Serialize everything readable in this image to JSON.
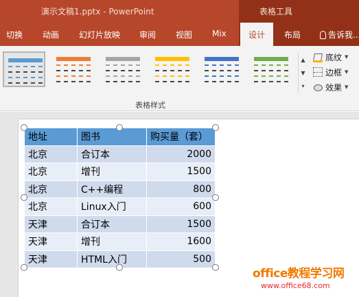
{
  "window": {
    "title": "演示文稿1.pptx - PowerPoint",
    "context_group": "表格工具"
  },
  "tabs": {
    "items": [
      "切换",
      "动画",
      "幻灯片放映",
      "审阅",
      "视图",
      "Mix",
      "设计",
      "布局"
    ],
    "active": "设计",
    "tell_me": "告诉我..."
  },
  "ribbon": {
    "group_label": "表格样式",
    "style_colors": [
      "#5b9bd5",
      "#ed7d31",
      "#a5a5a5",
      "#ffc000",
      "#4472c4",
      "#70ad47"
    ],
    "selected_style_index": 0,
    "shading": "底纹",
    "borders": "边框",
    "effects": "效果"
  },
  "table": {
    "headers": [
      "地址",
      "图书",
      "购买量（套）"
    ],
    "rows": [
      [
        "北京",
        "合订本",
        "2000"
      ],
      [
        "北京",
        "增刊",
        "1500"
      ],
      [
        "北京",
        "C++编程",
        "800"
      ],
      [
        "北京",
        "Linux入门",
        "600"
      ],
      [
        "天津",
        "合订本",
        "1500"
      ],
      [
        "天津",
        "增刊",
        "1600"
      ],
      [
        "天津",
        "HTML入门",
        "500"
      ]
    ],
    "header_color": "#5b9bd5",
    "band_colors": [
      "#cfdaed",
      "#e8eef7"
    ]
  },
  "watermark": {
    "line1": "office教程学习网",
    "line2": "www.office68.com"
  }
}
